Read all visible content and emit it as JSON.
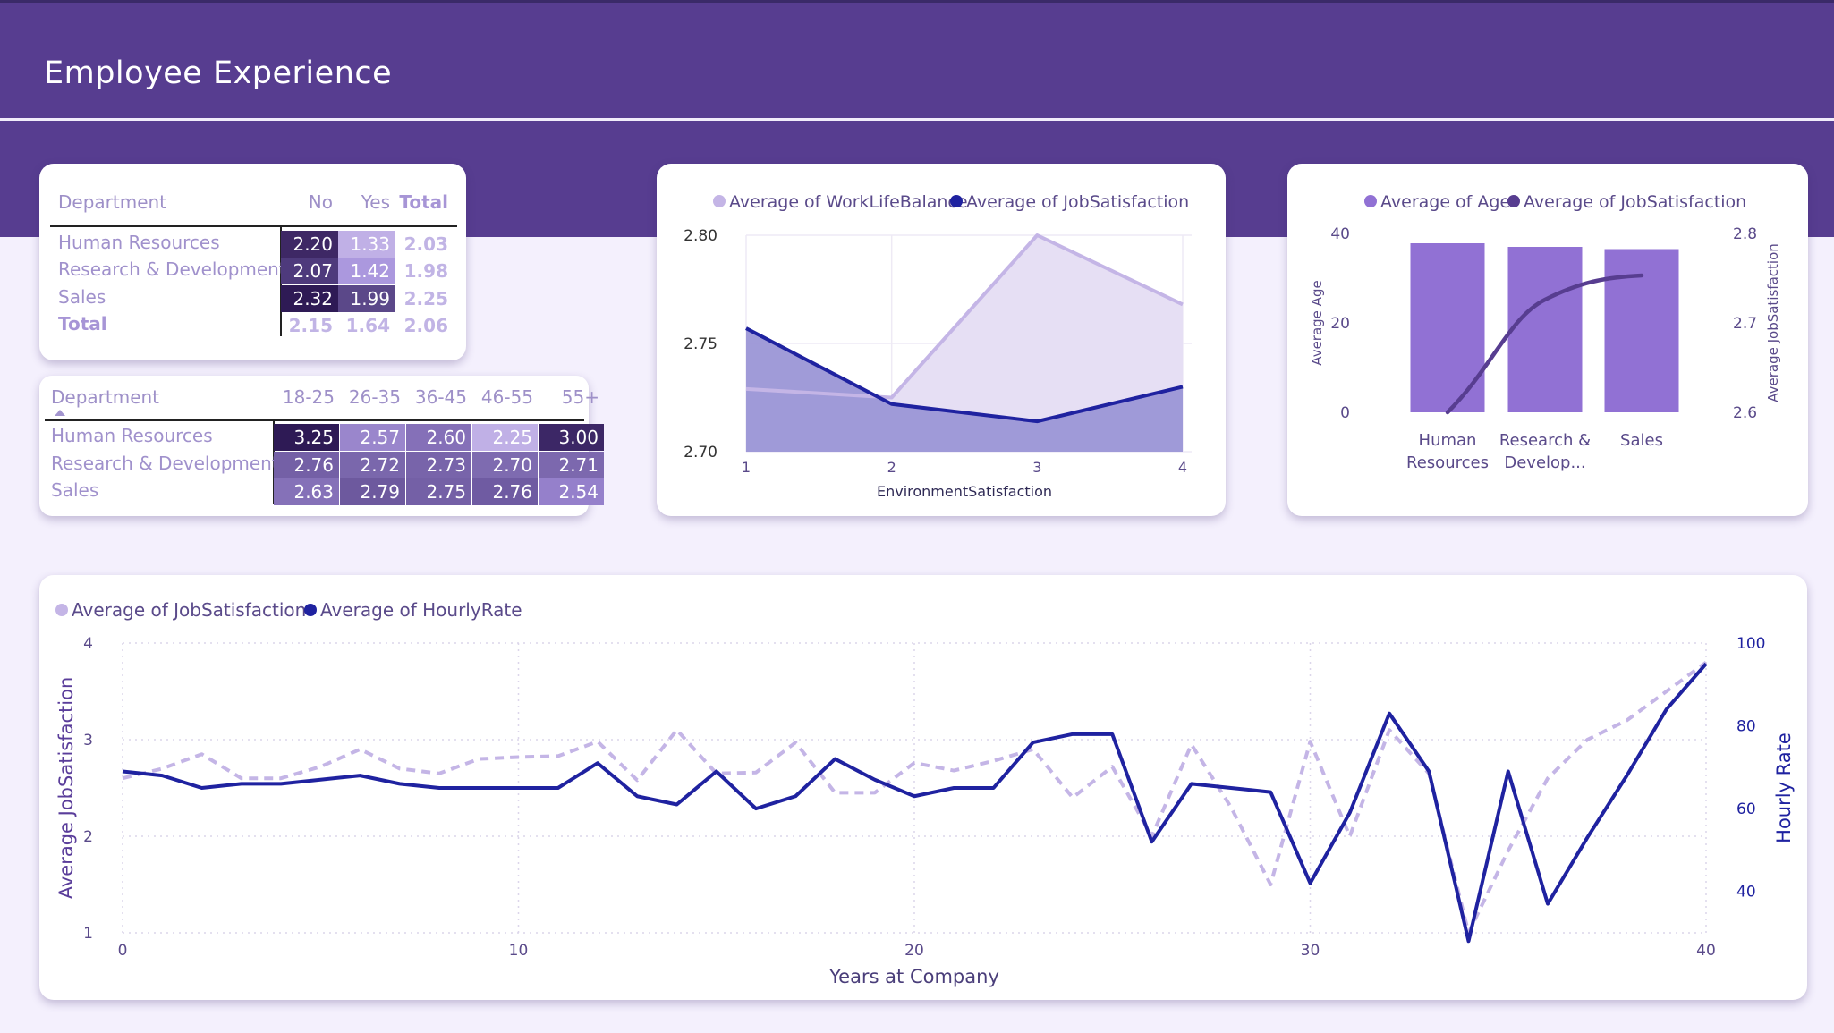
{
  "page": {
    "title": "Employee Experience"
  },
  "matrix1": {
    "row_header": "Department",
    "columns": [
      "No",
      "Yes",
      "Total"
    ],
    "rows": [
      {
        "label": "Human Resources",
        "values": [
          "2.20",
          "1.33"
        ],
        "total": "2.03"
      },
      {
        "label": "Research & Development",
        "values": [
          "2.07",
          "1.42"
        ],
        "total": "1.98"
      },
      {
        "label": "Sales",
        "values": [
          "2.32",
          "1.99"
        ],
        "total": "2.25"
      }
    ],
    "total_row": {
      "label": "Total",
      "values": [
        "2.15",
        "1.64"
      ],
      "total": "2.06"
    },
    "heat_colors": [
      [
        "#3e2865",
        "#c0b0e6"
      ],
      [
        "#4e3a7c",
        "#ab98de"
      ],
      [
        "#2e1a55",
        "#5b4889"
      ]
    ]
  },
  "matrix2": {
    "row_header": "Department",
    "sort_icon": "sort-up-icon",
    "columns": [
      "18-25",
      "26-35",
      "36-45",
      "46-55",
      "55+"
    ],
    "rows": [
      {
        "label": "Human Resources",
        "values": [
          "3.25",
          "2.57",
          "2.60",
          "2.25",
          "3.00"
        ]
      },
      {
        "label": "Research & Development",
        "values": [
          "2.76",
          "2.72",
          "2.73",
          "2.70",
          "2.71"
        ]
      },
      {
        "label": "Sales",
        "values": [
          "2.63",
          "2.79",
          "2.75",
          "2.76",
          "2.54"
        ]
      }
    ],
    "heat_colors": [
      [
        "#2e1a55",
        "#9a86cc",
        "#8570b8",
        "#c0b0e6",
        "#3c2766"
      ],
      [
        "#7460a6",
        "#7a67ac",
        "#7864aa",
        "#7e6bb0",
        "#7c68ae"
      ],
      [
        "#8571b8",
        "#6d599e",
        "#7460a6",
        "#6f5ba2",
        "#9580cb"
      ]
    ]
  },
  "chart_area": {
    "legend": [
      "Average of WorkLifeBalance",
      "Average of JobSatisfaction"
    ],
    "colors": [
      "#c4b5e6",
      "#1f22a0"
    ],
    "xlabel": "EnvironmentSatisfaction",
    "y_ticks": [
      "2.80",
      "2.75",
      "2.70"
    ],
    "x_ticks": [
      "1",
      "2",
      "3",
      "4"
    ]
  },
  "chart_combo": {
    "legend": [
      "Average of Age",
      "Average of JobSatisfaction"
    ],
    "colors": [
      "#9171d4",
      "#573d90"
    ],
    "ylabel_left": "Average Age",
    "ylabel_right": "Average JobSatisfaction",
    "left_ticks": [
      "40",
      "20",
      "0"
    ],
    "right_ticks": [
      "2.8",
      "2.7",
      "2.6"
    ],
    "categories": [
      [
        "Human",
        "Resources"
      ],
      [
        "Research &",
        "Develop..."
      ],
      [
        "Sales"
      ]
    ]
  },
  "chart_line": {
    "legend": [
      "Average of JobSatisfaction",
      "Average of HourlyRate"
    ],
    "colors": [
      "#c4b5e6",
      "#1f22a0"
    ],
    "xlabel": "Years at Company",
    "ylabel_left": "Average JobSatisfaction",
    "ylabel_right": "Hourly Rate",
    "left_ticks": [
      "4",
      "3",
      "2",
      "1"
    ],
    "right_ticks": [
      "100",
      "80",
      "60",
      "40"
    ],
    "x_ticks": [
      "0",
      "10",
      "20",
      "30",
      "40"
    ]
  },
  "chart_data": [
    {
      "type": "area",
      "x": [
        1,
        2,
        3,
        4
      ],
      "xlabel": "EnvironmentSatisfaction",
      "ylim": [
        2.7,
        2.8
      ],
      "series": [
        {
          "name": "Average of WorkLifeBalance",
          "values": [
            2.729,
            2.725,
            2.8,
            2.768
          ]
        },
        {
          "name": "Average of JobSatisfaction",
          "values": [
            2.757,
            2.722,
            2.714,
            2.73
          ]
        }
      ],
      "legend": "top",
      "grid": true
    },
    {
      "type": "bar",
      "categories": [
        "Human Resources",
        "Research & Development",
        "Sales"
      ],
      "series": [
        {
          "name": "Average of Age",
          "values": [
            37.8,
            37.0,
            36.5
          ],
          "axis": "left"
        },
        {
          "name": "Average of JobSatisfaction",
          "values": [
            2.6,
            2.726,
            2.753
          ],
          "axis": "right",
          "render": "line"
        }
      ],
      "ylim_left": [
        0,
        40
      ],
      "ylim_right": [
        2.6,
        2.8
      ],
      "ylabel_left": "Average Age",
      "ylabel_right": "Average JobSatisfaction",
      "legend": "top"
    },
    {
      "type": "line",
      "x": [
        0,
        1,
        2,
        3,
        4,
        5,
        6,
        7,
        8,
        9,
        10,
        11,
        12,
        13,
        14,
        15,
        16,
        17,
        18,
        19,
        20,
        21,
        22,
        23,
        24,
        25,
        26,
        27,
        28,
        29,
        30,
        31,
        32,
        33,
        34,
        35,
        36,
        37,
        38,
        39,
        40
      ],
      "xlabel": "Years at Company",
      "series": [
        {
          "name": "Average of JobSatisfaction",
          "axis": "left",
          "style": "dashed",
          "values": [
            2.6,
            2.7,
            2.85,
            2.6,
            2.6,
            2.72,
            2.9,
            2.7,
            2.65,
            2.8,
            2.82,
            2.83,
            2.98,
            2.58,
            3.1,
            2.65,
            2.66,
            2.97,
            2.45,
            2.45,
            2.76,
            2.68,
            2.78,
            2.9,
            2.4,
            2.72,
            2.0,
            2.95,
            2.3,
            1.5,
            2.98,
            2.0,
            3.1,
            2.65,
            1.0,
            1.85,
            2.6,
            3.0,
            3.2,
            3.5,
            3.8
          ]
        },
        {
          "name": "Average of HourlyRate",
          "axis": "right",
          "style": "solid",
          "values": [
            69,
            68,
            65,
            66,
            66,
            67,
            68,
            66,
            65,
            65,
            65,
            65,
            71,
            63,
            61,
            69,
            60,
            63,
            72,
            67,
            63,
            65,
            65,
            76,
            78,
            78,
            52,
            66,
            65,
            64,
            42,
            59,
            83,
            69,
            28,
            69,
            37,
            53,
            68,
            84,
            95
          ]
        }
      ],
      "ylim_left": [
        1,
        4
      ],
      "ylim_right": [
        30,
        100
      ],
      "ylabel_left": "Average JobSatisfaction",
      "ylabel_right": "Hourly Rate",
      "legend": "top-left",
      "grid": true
    }
  ]
}
